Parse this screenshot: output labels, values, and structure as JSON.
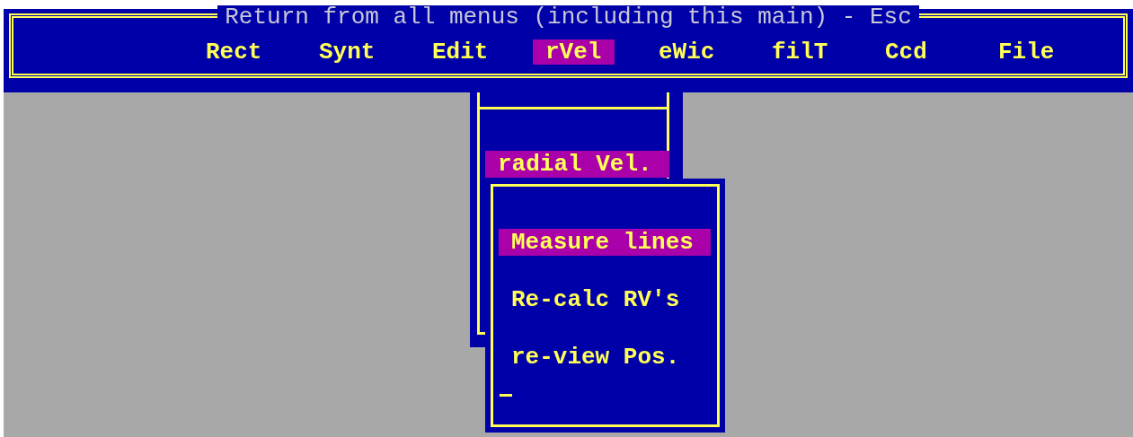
{
  "menu_bar": {
    "title": "Return from all menus (including this main) - Esc",
    "items": [
      {
        "label": "Rect",
        "selected": false
      },
      {
        "label": "Synt",
        "selected": false
      },
      {
        "label": "Edit",
        "selected": false
      },
      {
        "label": "rVel",
        "selected": true
      },
      {
        "label": "eWic",
        "selected": false
      },
      {
        "label": "filT",
        "selected": false
      },
      {
        "label": "Ccd",
        "selected": false
      },
      {
        "label": "File",
        "selected": false
      }
    ]
  },
  "submenu": {
    "items": [
      {
        "label": "radial Vel.",
        "selected": true
      }
    ]
  },
  "sub_submenu": {
    "items": [
      {
        "label": "Measure lines",
        "selected": true
      },
      {
        "label": "Re-calc RV's",
        "selected": false
      },
      {
        "label": "re-view Pos.",
        "selected": false
      }
    ]
  }
}
